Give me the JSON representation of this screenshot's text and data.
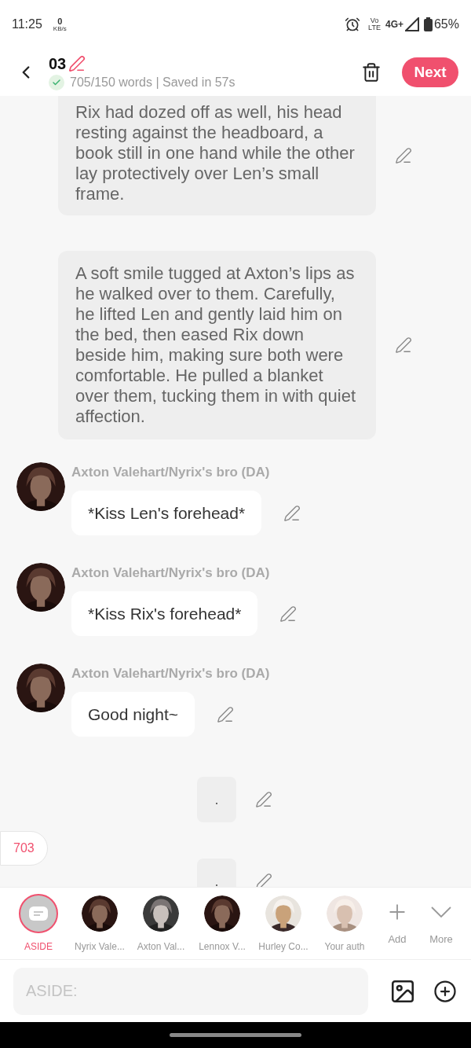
{
  "status_bar": {
    "time": "11:25",
    "net_speed": "0",
    "net_unit": "KB/s",
    "volte_top": "Vo",
    "volte_bottom": "LTE",
    "network": "4G+",
    "battery": "65%"
  },
  "header": {
    "title": "03",
    "stats": "705/150 words | Saved in 57s",
    "next_button": "Next"
  },
  "messages": [
    {
      "kind": "narration",
      "text": "Rix had dozed off as well, his head resting against the headboard, a book still in one hand while the other lay protectively over Len’s small frame."
    },
    {
      "kind": "narration",
      "text": "A soft smile tugged at Axton’s lips as he walked over to them. Carefully, he lifted Len and gently laid him on the bed, then eased Rix down beside him, making sure both were comfortable. He pulled a blanket over them, tucking them in with quiet affection."
    },
    {
      "kind": "dialogue",
      "name": "Axton Valehart/Nyrix's bro (DA)",
      "text": "*Kiss Len's forehead*"
    },
    {
      "kind": "dialogue",
      "name": "Axton Valehart/Nyrix's bro (DA)",
      "text": "*Kiss Rix's forehead*"
    },
    {
      "kind": "dialogue",
      "name": "Axton Valehart/Nyrix's bro (DA)",
      "text": "Good night~"
    },
    {
      "kind": "aside",
      "text": "."
    },
    {
      "kind": "aside",
      "text": "."
    }
  ],
  "word_count_badge": "703",
  "characters": [
    {
      "kind": "aside",
      "name": "ASIDE",
      "selected": true
    },
    {
      "kind": "avatar",
      "name": "Nyrix Vale...",
      "selected": false
    },
    {
      "kind": "avatar",
      "name": "Axton Val...",
      "selected": false
    },
    {
      "kind": "avatar",
      "name": "Lennox V...",
      "selected": false
    },
    {
      "kind": "avatar",
      "name": "Hurley Co...",
      "selected": false
    },
    {
      "kind": "avatar",
      "name": "Your auth",
      "selected": false
    }
  ],
  "add_button": "Add",
  "more_button": "More",
  "input": {
    "placeholder": "ASIDE:"
  }
}
